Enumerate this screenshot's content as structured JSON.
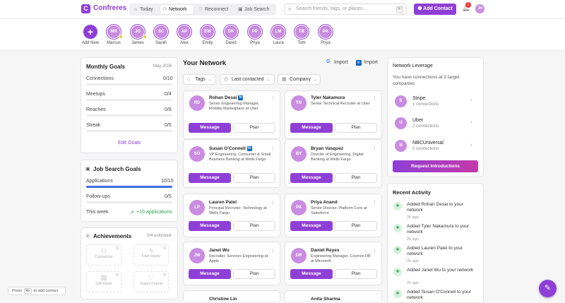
{
  "app": {
    "name": "Confreres",
    "logo_letter": "C"
  },
  "nav": {
    "tabs": [
      {
        "label": "Today",
        "icon": "sun-icon"
      },
      {
        "label": "Network",
        "icon": "users-icon"
      },
      {
        "label": "Reconnect",
        "icon": "heart-icon"
      },
      {
        "label": "Job Search",
        "icon": "briefcase-icon"
      }
    ],
    "active": "Network"
  },
  "search": {
    "placeholder": "Search friends, tags, or places...",
    "shortcut": "⌘/"
  },
  "header": {
    "add_contact": "Add Contact",
    "notifications": "1",
    "user_initials": "JH"
  },
  "stories": [
    {
      "initials": "+",
      "label": "Add New"
    },
    {
      "initials": "MR",
      "label": "Marcus",
      "flag": true
    },
    {
      "initials": "JO",
      "label": "James",
      "flag": true
    },
    {
      "initials": "SC",
      "label": "Sarah"
    },
    {
      "initials": "AP",
      "label": "Alex"
    },
    {
      "initials": "EW",
      "label": "Emily"
    },
    {
      "initials": "DK",
      "label": "David"
    },
    {
      "initials": "PP",
      "label": "Priya"
    },
    {
      "initials": "LM",
      "label": "Laura"
    },
    {
      "initials": "TB",
      "label": "Tom"
    },
    {
      "initials": "PA",
      "label": "Priya"
    }
  ],
  "monthly_goals": {
    "title": "Monthly Goals",
    "period": "May 2026",
    "items": [
      {
        "label": "Connections",
        "value": "0/10",
        "progress": 0
      },
      {
        "label": "Meetups",
        "value": "0/4",
        "progress": 0
      },
      {
        "label": "Reaches",
        "value": "0/8",
        "progress": 0
      },
      {
        "label": "Streak",
        "value": "0/5",
        "progress": 0
      }
    ],
    "edit_label": "Edit Goals"
  },
  "job_goals": {
    "title": "Job Search Goals",
    "items": [
      {
        "label": "Applications",
        "value": "10/10",
        "progress": 1.0
      },
      {
        "label": "Follow-ups",
        "value": "0/5",
        "progress": 0
      }
    ],
    "week_label": "This week",
    "week_value": "+10 applications"
  },
  "achievements": {
    "title": "Achievements",
    "count": "0/4 unlocked",
    "items": [
      {
        "label": "Connector",
        "icon": "users-icon"
      },
      {
        "label": "Fast Reply",
        "icon": "bolt-icon"
      },
      {
        "label": "Gift Giver",
        "icon": "gift-icon"
      },
      {
        "label": "Super Friend",
        "icon": "heart-icon"
      }
    ]
  },
  "network": {
    "title": "Your Network",
    "import_google": "Import",
    "import_linkedin": "Import",
    "filters": [
      "Tags",
      "Last contacted",
      "Company"
    ],
    "message_label": "Message",
    "plan_label": "Plan",
    "contacts": [
      {
        "initials": "RD",
        "name": "Rohan Desai",
        "linkedin": true,
        "title": "Senior Engineering Manager, Mobility Marketplace at Uber"
      },
      {
        "initials": "TN",
        "name": "Tyler Nakamura",
        "linkedin": false,
        "title": "Senior Technical Recruiter at Uber"
      },
      {
        "initials": "SO",
        "name": "Susan O'Connell",
        "linkedin": true,
        "title": "VP Engineering, Consumer & Small Business Banking at Wells Fargo"
      },
      {
        "initials": "BV",
        "name": "Bryan Vasquez",
        "linkedin": false,
        "title": "Director of Engineering, Digital Banking at Wells Fargo"
      },
      {
        "initials": "LP",
        "name": "Lauren Patel",
        "linkedin": false,
        "title": "Principal Recruiter, Technology at Wells Fargo"
      },
      {
        "initials": "PA",
        "name": "Priya Anand",
        "linkedin": false,
        "title": "Senior Director, Platform Core at Salesforce"
      },
      {
        "initials": "JW",
        "name": "Janet Wu",
        "linkedin": false,
        "title": "Recruiter, Services Engineering at Apple"
      },
      {
        "initials": "DR",
        "name": "Daniel Reyes",
        "linkedin": false,
        "title": "Engineering Manager, Cosmos DB at Microsoft"
      },
      {
        "initials": "CL",
        "name": "Christine Lin",
        "linkedin": false,
        "title": ""
      },
      {
        "initials": "AS",
        "name": "Anita Sharma",
        "linkedin": false,
        "title": ""
      }
    ]
  },
  "leverage": {
    "title": "Network Leverage",
    "subtitle": "You have connections at 3 target companies",
    "companies": [
      {
        "initial": "S",
        "name": "Stripe",
        "count": "1 connections"
      },
      {
        "initial": "U",
        "name": "Uber",
        "count": "2 connections"
      },
      {
        "initial": "N",
        "name": "NBCUniversal",
        "count": "0 connections"
      }
    ],
    "button": "Request Introductions"
  },
  "activity": {
    "title": "Recent Activity",
    "items": [
      {
        "text": "Added Rohan Desai to your network",
        "time": "2h ago"
      },
      {
        "text": "Added Tyler Nakamura to your network",
        "time": "2h ago"
      },
      {
        "text": "Added Lauren Patel to your network",
        "time": "2h ago"
      },
      {
        "text": "Added Janet Wu to your network",
        "time": "2h ago"
      },
      {
        "text": "Added Susan O'Connell to your network",
        "time": ""
      }
    ]
  },
  "hint": {
    "press": "Press",
    "key": "⌘K",
    "rest": "to add contact"
  },
  "colors": {
    "accent": "#8e3fd6",
    "avatar": "#c98ce0",
    "progress": "#3a6fe0",
    "linkedin": "#0a66c2"
  }
}
